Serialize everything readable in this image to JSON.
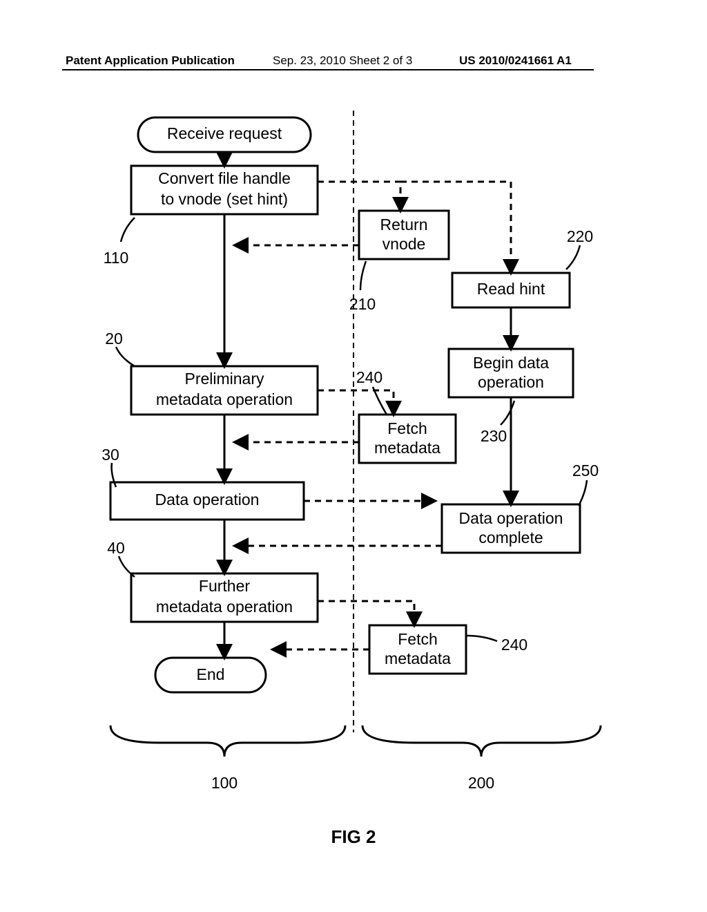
{
  "header": {
    "left": "Patent Application Publication",
    "center": "Sep. 23, 2010   Sheet 2 of 3",
    "right": "US 2010/0241661 A1"
  },
  "figure_label": "FIG 2",
  "bracket_labels": {
    "left": "100",
    "right": "200"
  },
  "refs": {
    "r110": "110",
    "r20": "20",
    "r30": "30",
    "r40": "40",
    "r210": "210",
    "r220": "220",
    "r230": "230",
    "r240a": "240",
    "r250": "250",
    "r240b": "240"
  },
  "nodes": {
    "receive": {
      "line1": "Receive request"
    },
    "convert": {
      "line1": "Convert file handle",
      "line2": "to vnode (set hint)"
    },
    "prelim": {
      "line1": "Preliminary",
      "line2": "metadata operation"
    },
    "dataop": {
      "line1": "Data operation"
    },
    "further": {
      "line1": "Further",
      "line2": "metadata operation"
    },
    "end": {
      "line1": "End"
    },
    "returnv": {
      "line1": "Return",
      "line2": "vnode"
    },
    "readhint": {
      "line1": "Read hint"
    },
    "begindata": {
      "line1": "Begin data",
      "line2": "operation"
    },
    "fetch1": {
      "line1": "Fetch",
      "line2": "metadata"
    },
    "complete": {
      "line1": "Data operation",
      "line2": "complete"
    },
    "fetch2": {
      "line1": "Fetch",
      "line2": "metadata"
    }
  },
  "chart_data": {
    "type": "diagram",
    "title": "FIG 2",
    "columns": [
      {
        "id": 100,
        "label": "100"
      },
      {
        "id": 200,
        "label": "200"
      }
    ],
    "nodes": [
      {
        "id": "receive",
        "column": 100,
        "shape": "terminator",
        "text": "Receive request"
      },
      {
        "id": "convert",
        "column": 100,
        "shape": "process",
        "text": "Convert file handle to vnode (set hint)",
        "ref": 110
      },
      {
        "id": "prelim",
        "column": 100,
        "shape": "process",
        "text": "Preliminary metadata operation",
        "ref": 20
      },
      {
        "id": "dataop",
        "column": 100,
        "shape": "process",
        "text": "Data operation",
        "ref": 30
      },
      {
        "id": "further",
        "column": 100,
        "shape": "process",
        "text": "Further metadata operation",
        "ref": 40
      },
      {
        "id": "end",
        "column": 100,
        "shape": "terminator",
        "text": "End"
      },
      {
        "id": "returnv",
        "column": 200,
        "shape": "process",
        "text": "Return vnode",
        "ref": 210
      },
      {
        "id": "readhint",
        "column": 200,
        "shape": "process",
        "text": "Read hint",
        "ref": 220
      },
      {
        "id": "begindata",
        "column": 200,
        "shape": "process",
        "text": "Begin data operation",
        "ref": 230
      },
      {
        "id": "fetch1",
        "column": 200,
        "shape": "process",
        "text": "Fetch metadata",
        "ref": 240
      },
      {
        "id": "complete",
        "column": 200,
        "shape": "process",
        "text": "Data operation complete",
        "ref": 250
      },
      {
        "id": "fetch2",
        "column": 200,
        "shape": "process",
        "text": "Fetch metadata",
        "ref": 240
      }
    ],
    "edges": [
      {
        "from": "receive",
        "to": "convert",
        "style": "solid"
      },
      {
        "from": "convert",
        "to": "prelim",
        "style": "solid"
      },
      {
        "from": "prelim",
        "to": "dataop",
        "style": "solid"
      },
      {
        "from": "dataop",
        "to": "further",
        "style": "solid"
      },
      {
        "from": "further",
        "to": "end",
        "style": "solid"
      },
      {
        "from": "readhint",
        "to": "begindata",
        "style": "solid"
      },
      {
        "from": "convert",
        "to": "returnv",
        "style": "dashed"
      },
      {
        "from": "convert",
        "to": "readhint",
        "style": "dashed"
      },
      {
        "from": "returnv",
        "to": "convert",
        "style": "dashed",
        "note": "return flow to left column"
      },
      {
        "from": "prelim",
        "to": "fetch1",
        "style": "dashed"
      },
      {
        "from": "fetch1",
        "to": "prelim",
        "style": "dashed",
        "note": "back to left column below prelim"
      },
      {
        "from": "dataop",
        "to": "begindata",
        "style": "dashed"
      },
      {
        "from": "complete",
        "to": "dataop",
        "style": "dashed",
        "note": "back to left column below dataop"
      },
      {
        "from": "begindata",
        "to": "complete",
        "style": "solid"
      },
      {
        "from": "further",
        "to": "fetch2",
        "style": "dashed"
      },
      {
        "from": "fetch2",
        "to": "further",
        "style": "dashed"
      }
    ]
  }
}
